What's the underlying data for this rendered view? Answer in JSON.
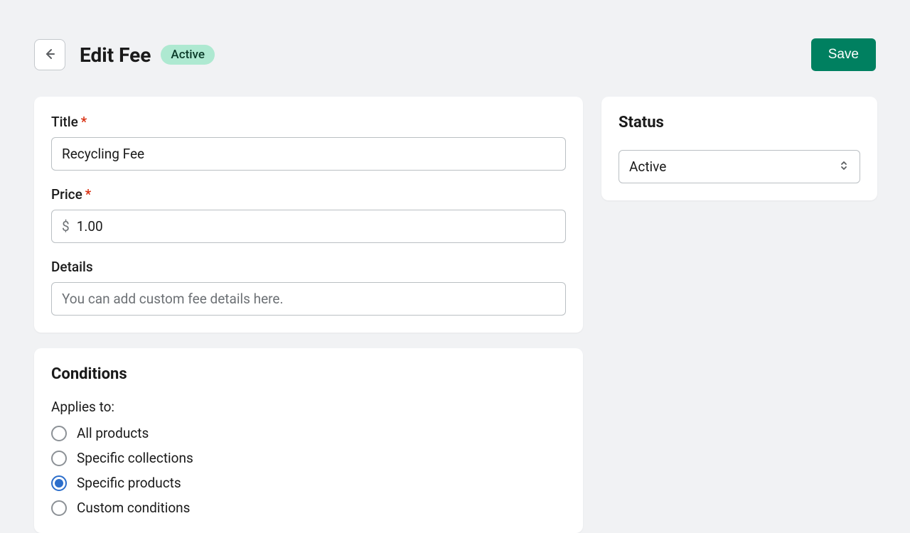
{
  "header": {
    "title": "Edit Fee",
    "badge": "Active",
    "save_label": "Save"
  },
  "fields": {
    "title_label": "Title",
    "title_value": "Recycling Fee",
    "price_label": "Price",
    "price_prefix": "$",
    "price_value": "1.00",
    "details_label": "Details",
    "details_placeholder": "You can add custom fee details here."
  },
  "conditions": {
    "heading": "Conditions",
    "applies_label": "Applies to:",
    "options": [
      {
        "label": "All products",
        "selected": false
      },
      {
        "label": "Specific collections",
        "selected": false
      },
      {
        "label": "Specific products",
        "selected": true
      },
      {
        "label": "Custom conditions",
        "selected": false
      }
    ]
  },
  "status": {
    "heading": "Status",
    "value": "Active"
  }
}
